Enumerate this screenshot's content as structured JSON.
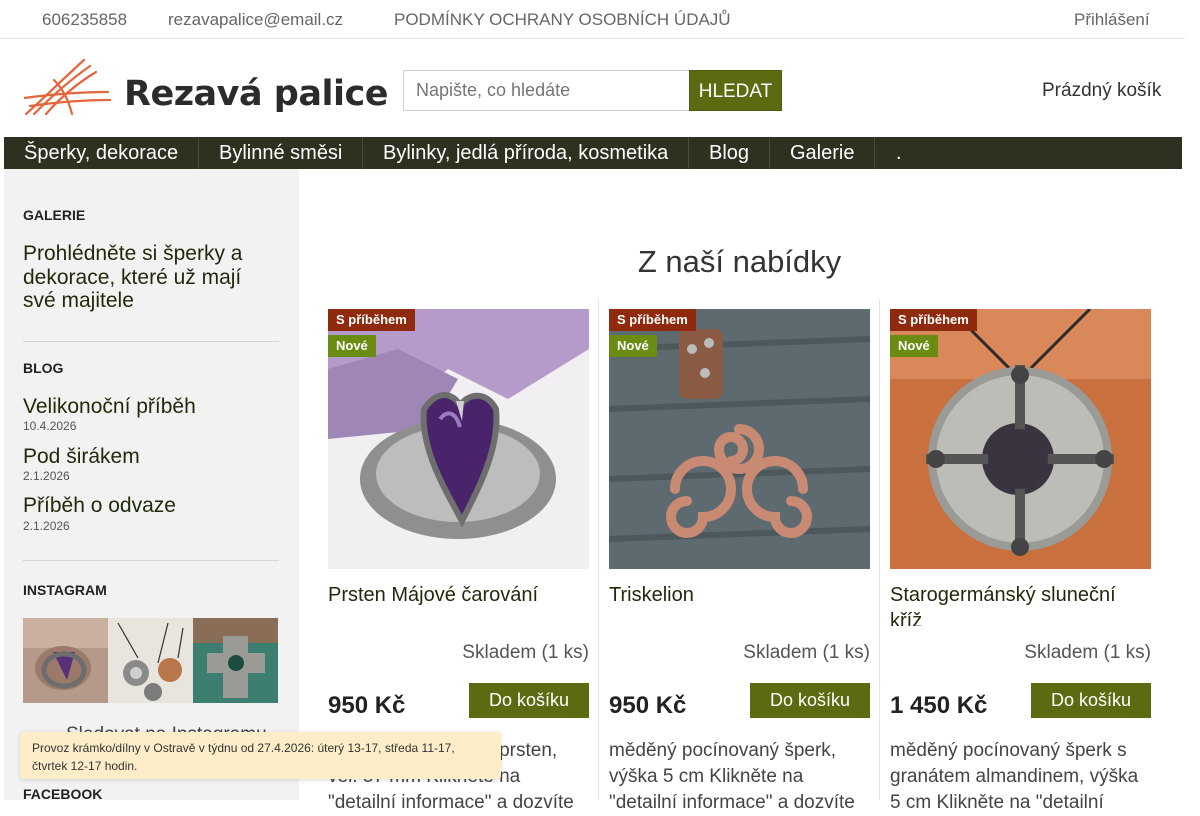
{
  "topbar": {
    "phone": "606235858",
    "email": "rezavapalice@email.cz",
    "privacy_link": "PODMÍNKY OCHRANY OSOBNÍCH ÚDAJŮ",
    "login": "Přihlášení"
  },
  "header": {
    "logo_text": "Rezavá palice",
    "search_placeholder": "Napište, co hledáte",
    "search_button": "HLEDAT",
    "cart_label": "Prázdný košík"
  },
  "nav": {
    "items": [
      {
        "label": "Šperky, dekorace"
      },
      {
        "label": "Bylinné směsi"
      },
      {
        "label": "Bylinky, jedlá příroda, kosmetika"
      },
      {
        "label": "Blog"
      },
      {
        "label": "Galerie"
      },
      {
        "label": "."
      }
    ]
  },
  "sidebar": {
    "gallery": {
      "heading": "GALERIE",
      "link": "Prohlédněte si šperky a dekorace, které už mají své majitele"
    },
    "blog": {
      "heading": "BLOG",
      "posts": [
        {
          "title": "Velikonoční příběh",
          "date": "10.4.2026"
        },
        {
          "title": "Pod širákem",
          "date": "2.1.2026"
        },
        {
          "title": "Příběh o odvaze",
          "date": "2.1.2026"
        }
      ]
    },
    "instagram": {
      "heading": "INSTAGRAM",
      "follow": "Sledovat na Instagramu"
    },
    "facebook": {
      "heading": "FACEBOOK"
    }
  },
  "main": {
    "heading": "Z naší nabídky",
    "products": [
      {
        "badge_story": "S příběhem",
        "badge_new": "Nové",
        "name": "Prsten Májové čarování",
        "stock": "Skladem (1 ks)",
        "price": "950 Kč",
        "buy": "Do košíku",
        "desc": "stříbrný pocínovaný prsten, vel. 57 mm Klikněte na \"detailní informace\" a dozvíte"
      },
      {
        "badge_story": "S příběhem",
        "badge_new": "Nové",
        "name": "Triskelion",
        "stock": "Skladem (1 ks)",
        "price": "950 Kč",
        "buy": "Do košíku",
        "desc": "měděný pocínovaný šperk, výška 5 cm Klikněte na \"detailní informace\" a dozvíte"
      },
      {
        "badge_story": "S příběhem",
        "badge_new": "Nové",
        "name": "Starogermánský sluneční kříž",
        "stock": "Skladem (1 ks)",
        "price": "1 450 Kč",
        "buy": "Do košíku",
        "desc": "měděný pocínovaný šperk s granátem almandinem, výška 5 cm Klikněte na \"detailní"
      }
    ]
  },
  "notice": {
    "text": "Provoz krámko/dílny v Ostravě v týdnu od 27.4.2026: úterý 13-17, středa 11-17, čtvrtek 12-17 hodin."
  },
  "colors": {
    "accent": "#5b6b12",
    "nav_bg": "#2e3020",
    "badge_story": "#8f2a0e",
    "badge_new": "#6a8c12",
    "sidebar_bg": "#f2f2f2",
    "notice_bg": "#fdeec9",
    "logo_strokes": "#e4643b"
  },
  "icons": {
    "phone": "phone-icon",
    "email": "envelope-icon",
    "cart": "cart-icon",
    "instagram": "instagram-icon",
    "close": "close-icon"
  }
}
